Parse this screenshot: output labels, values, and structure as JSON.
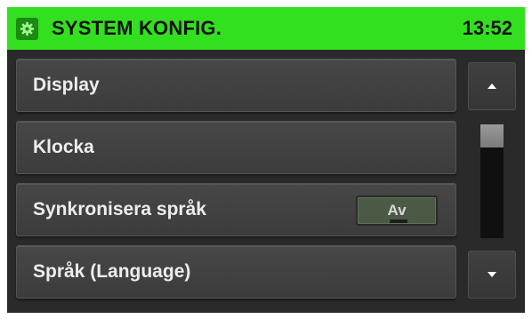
{
  "header": {
    "title": "SYSTEM KONFIG.",
    "time": "13:52",
    "icon": "gear-icon",
    "accent_color": "#33e01f"
  },
  "menu": {
    "items": [
      {
        "label": "Display"
      },
      {
        "label": "Klocka"
      },
      {
        "label": "Synkronisera språk",
        "toggle": {
          "value": "Av",
          "state": "off"
        }
      },
      {
        "label": "Språk (Language)"
      }
    ]
  },
  "scrollbar": {
    "up_icon": "triangle-up-icon",
    "down_icon": "triangle-down-icon",
    "position_fraction": 0.0
  }
}
